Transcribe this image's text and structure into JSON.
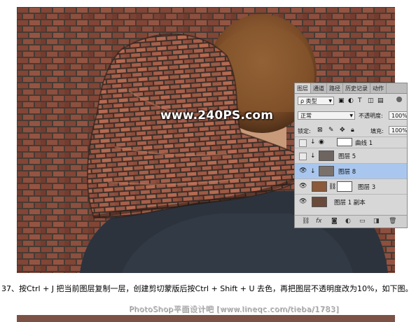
{
  "watermark": "www.240PS.com",
  "layers_panel": {
    "tabs": [
      "图层",
      "通道",
      "路径",
      "历史记录",
      "动作"
    ],
    "filter_label": "ρ 类型",
    "blend_mode": "正常",
    "opacity_label": "不透明度:",
    "opacity_value": "100%",
    "lock_label": "锁定:",
    "fill_label": "填充:",
    "fill_value": "100%",
    "layers": [
      {
        "name": "曲线 1",
        "visible": false,
        "selected": false
      },
      {
        "name": "图层 5",
        "visible": false,
        "selected": false
      },
      {
        "name": "图层 8",
        "visible": true,
        "selected": true
      },
      {
        "name": "图层 3",
        "visible": true,
        "selected": false
      },
      {
        "name": "图层 1 副本",
        "visible": true,
        "selected": false
      }
    ],
    "bottom_icons": [
      "link-icon",
      "fx-icon",
      "mask-icon",
      "adjustment-icon",
      "group-icon",
      "new-layer-icon",
      "trash-icon"
    ]
  },
  "caption": "37、按Ctrl + J 把当前图层复制一层，创建剪切蒙版后按Ctrl + Shift + U 去色，再把图层不透明度改为10%，如下图。",
  "footer": "PhotoShop平面设计吧 [www.lineqc.com/tieba/1783]",
  "colors": {
    "brick": "#8a4a3a",
    "mortar": "#5a4a40",
    "hair": "#8a5a30",
    "shirt": "#2b323c",
    "selection": "#a9c7ee"
  }
}
